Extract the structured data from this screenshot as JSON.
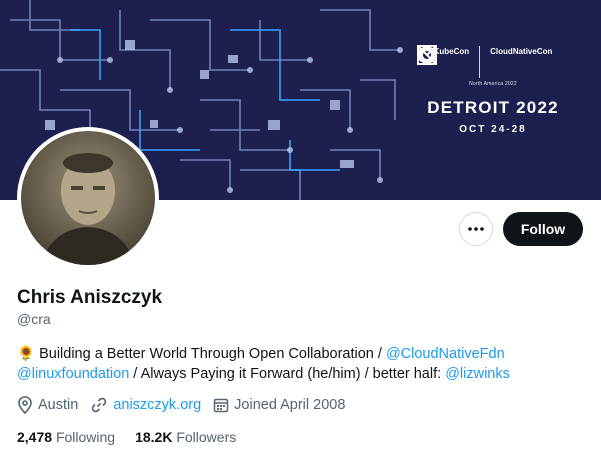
{
  "banner": {
    "logo_left": "KubeCon",
    "logo_right": "CloudNativeCon",
    "subtitle": "North America 2022",
    "city": "DETROIT 2022",
    "dates": "OCT 24-28",
    "bg_color": "#1d1f4f"
  },
  "actions": {
    "more_icon": "more-horizontal-icon",
    "follow_label": "Follow"
  },
  "profile": {
    "name": "Chris Aniszczyk",
    "handle": "@cra",
    "bio": {
      "emoji": "🌻",
      "text1": " Building a Better World Through Open Collaboration / ",
      "mention1": "@CloudNativeFdn",
      "mention2": "@linuxfoundation",
      "text2": " / Always Paying it Forward (he/him) / better half: ",
      "mention3": "@lizwinks"
    },
    "location": "Austin",
    "website": "aniszczyk.org",
    "joined": "Joined April 2008",
    "following_count": "2,478",
    "following_label": "Following",
    "followers_count": "18.2K",
    "followers_label": "Followers"
  },
  "colors": {
    "link": "#1d9bf0",
    "follow_bg": "#0f1419",
    "muted": "#536471"
  }
}
